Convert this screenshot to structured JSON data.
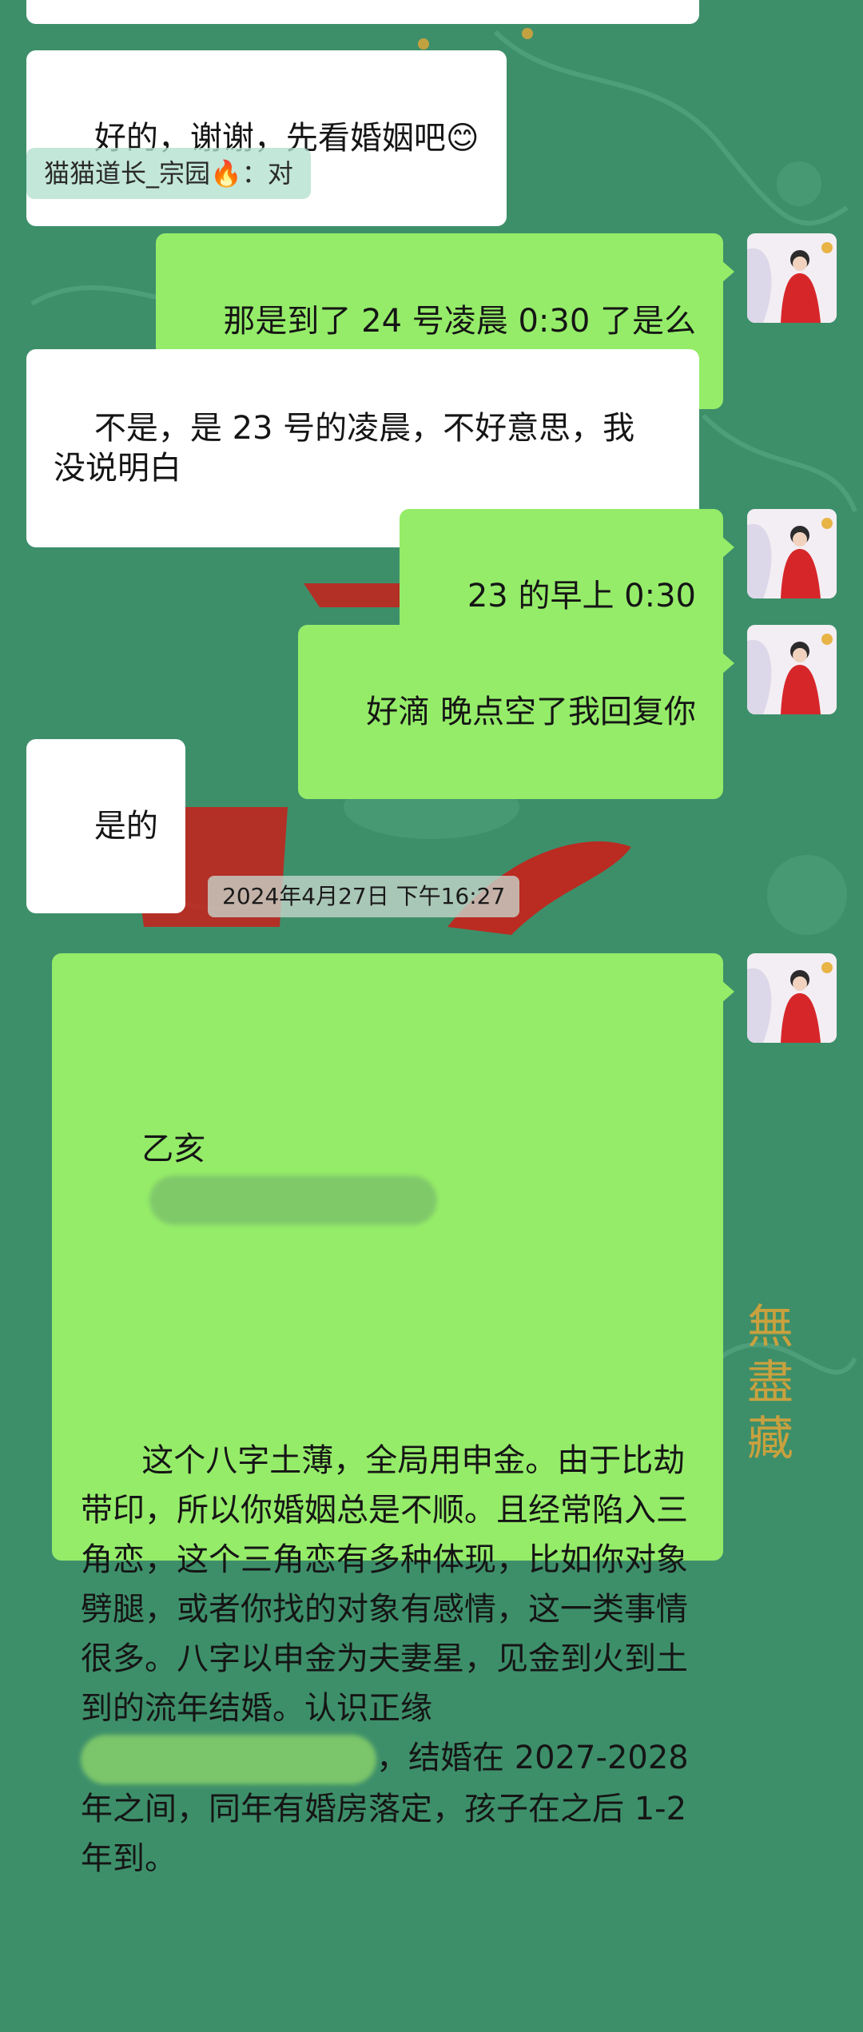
{
  "messages": {
    "m0_cut": "",
    "m1": "好的，谢谢，先看婚姻吧😊",
    "quote_m1": "猫猫道长_宗园🔥：对",
    "m2": "那是到了 24 号凌晨 0:30 了是么",
    "m3": "不是，是 23 号的凌晨，不好意思，我\n没说明白",
    "m4": "23 的早上 0:30",
    "m5": "好滴 晚点空了我回复你",
    "m6": "是的",
    "timestamp": "2024年4月27日 下午16:27",
    "m7_l1": "乙亥",
    "m7_body": "这个八字土薄，全局用申金。由于比劫带印，所以你婚姻总是不顺。且经常陷入三角恋，这个三角恋有多种体现，比如你对象劈腿，或者你找的对象有感情，这一类事情很多。八字以申金为夫妻星，见金到火到土到的流年结婚。认识正缘",
    "m7_tail_punct": "，",
    "m7_body2": "结婚在 2027-2028 年之间，同年有婚房落定，孩子在之后 1-2 年到。"
  },
  "watermark": "無盡藏",
  "colors": {
    "background": "#3d8f6a",
    "bubble_out": "#95ec69",
    "bubble_in": "#ffffff",
    "deco_red": "#c8201a",
    "deco_gold": "#d9a43a"
  }
}
